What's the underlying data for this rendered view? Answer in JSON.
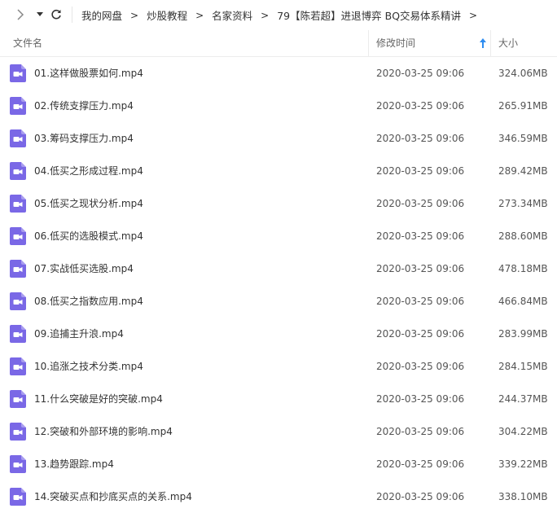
{
  "breadcrumb": [
    "我的网盘",
    "炒股教程",
    "名家资料",
    "79【陈若超】进退博弈 BQ交易体系精讲"
  ],
  "columns": {
    "name": "文件名",
    "modified": "修改时间",
    "size": "大小"
  },
  "colors": {
    "video_icon": "#7a68e6",
    "sort_arrow": "#2d8cf0"
  },
  "icons": {
    "back": "chevron-right-icon",
    "dropdown": "caret-down-icon",
    "refresh": "refresh-icon",
    "file": "video-file-icon",
    "sort": "sort-up-arrow-icon"
  },
  "files": [
    {
      "name": "01.这样做股票如何.mp4",
      "date": "2020-03-25 09:06",
      "size": "324.06MB"
    },
    {
      "name": "02.传统支撑压力.mp4",
      "date": "2020-03-25 09:06",
      "size": "265.91MB"
    },
    {
      "name": "03.筹码支撑压力.mp4",
      "date": "2020-03-25 09:06",
      "size": "346.59MB"
    },
    {
      "name": "04.低买之形成过程.mp4",
      "date": "2020-03-25 09:06",
      "size": "289.42MB"
    },
    {
      "name": "05.低买之现状分析.mp4",
      "date": "2020-03-25 09:06",
      "size": "273.34MB"
    },
    {
      "name": "06.低买的选股模式.mp4",
      "date": "2020-03-25 09:06",
      "size": "288.60MB"
    },
    {
      "name": "07.实战低买选股.mp4",
      "date": "2020-03-25 09:06",
      "size": "478.18MB"
    },
    {
      "name": "08.低买之指数应用.mp4",
      "date": "2020-03-25 09:06",
      "size": "466.84MB"
    },
    {
      "name": "09.追捕主升浪.mp4",
      "date": "2020-03-25 09:06",
      "size": "283.99MB"
    },
    {
      "name": "10.追涨之技术分类.mp4",
      "date": "2020-03-25 09:06",
      "size": "284.15MB"
    },
    {
      "name": "11.什么突破是好的突破.mp4",
      "date": "2020-03-25 09:06",
      "size": "244.37MB"
    },
    {
      "name": "12.突破和外部环境的影响.mp4",
      "date": "2020-03-25 09:06",
      "size": "304.22MB"
    },
    {
      "name": "13.趋势跟踪.mp4",
      "date": "2020-03-25 09:06",
      "size": "339.22MB"
    },
    {
      "name": "14.突破买点和抄底买点的关系.mp4",
      "date": "2020-03-25 09:06",
      "size": "338.10MB"
    }
  ]
}
